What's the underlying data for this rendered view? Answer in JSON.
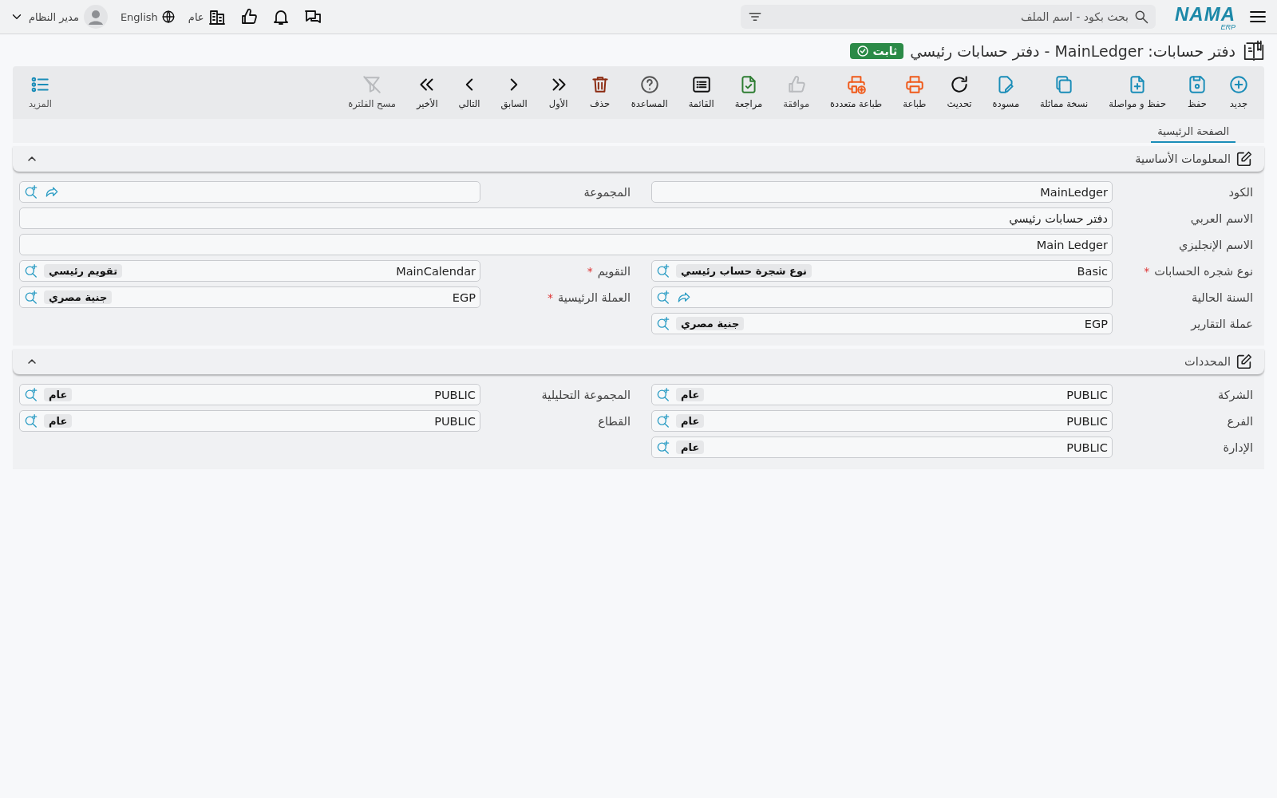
{
  "topbar": {
    "logo": {
      "name": "NAMA",
      "sub": "ERP"
    },
    "search": {
      "placeholder": "بحث بكود - اسم الملف"
    },
    "branch": "عام",
    "language": "English",
    "user": "مدير النظام"
  },
  "title": {
    "text": "دفتر حسابات: MainLedger - دفتر حسابات رئيسي",
    "status": "ثابت"
  },
  "toolbar": [
    {
      "label": "جديد",
      "kind": "new",
      "disabled": false
    },
    {
      "label": "حفظ",
      "kind": "save",
      "disabled": false
    },
    {
      "label": "حفظ و مواصلة",
      "kind": "continue",
      "disabled": false
    },
    {
      "label": "نسخة مماثلة",
      "kind": "duplicate",
      "disabled": false
    },
    {
      "label": "مسودة",
      "kind": "draft",
      "disabled": false
    },
    {
      "label": "تحديث",
      "kind": "refresh",
      "disabled": false
    },
    {
      "label": "طباعة",
      "kind": "print",
      "disabled": false
    },
    {
      "label": "طباعة متعددة",
      "kind": "multiprint",
      "disabled": false
    },
    {
      "label": "موافقة",
      "kind": "approve",
      "disabled": true
    },
    {
      "label": "مراجعة",
      "kind": "review",
      "disabled": false
    },
    {
      "label": "القائمة",
      "kind": "list",
      "disabled": false
    },
    {
      "label": "المساعدة",
      "kind": "help",
      "disabled": false
    },
    {
      "label": "حذف",
      "kind": "delete",
      "disabled": false
    },
    {
      "label": "الأول",
      "kind": "first",
      "disabled": false
    },
    {
      "label": "السابق",
      "kind": "previous",
      "disabled": false
    },
    {
      "label": "التالي",
      "kind": "next",
      "disabled": false
    },
    {
      "label": "الأخير",
      "kind": "last",
      "disabled": false
    },
    {
      "label": "مسح الفلترة",
      "kind": "clearfilter",
      "disabled": true
    }
  ],
  "more": {
    "label": "المزيد"
  },
  "tabs": [
    {
      "label": "الصفحة الرئيسية",
      "selected": true
    }
  ],
  "sections": [
    {
      "title": "المعلومات الأساسية",
      "expanded": true,
      "rows": [
        [
          {
            "label": "الكود",
            "kind": "text",
            "value": "MainLedger"
          },
          {
            "label": "المجموعة",
            "kind": "lookup",
            "goto": true
          }
        ],
        [
          {
            "label": "الاسم العربي",
            "kind": "text",
            "value": "دفتر حسابات رئيسي",
            "wide": true
          }
        ],
        [
          {
            "label": "الاسم الإنجليزي",
            "kind": "text",
            "value": "Main Ledger",
            "wide": true
          }
        ],
        [
          {
            "label": "نوع شجره الحسابات",
            "kind": "lookup",
            "required_mark": "*",
            "value": "Basic",
            "tag": "نوع شجرة حساب رئيسي"
          },
          {
            "label": "التقويم",
            "kind": "lookup",
            "required_mark": "*",
            "value": "MainCalendar",
            "tag": "تقويم رئيسي"
          }
        ],
        [
          {
            "label": "السنة الحالية",
            "kind": "lookup",
            "goto": true
          },
          {
            "label": "العملة الرئيسية",
            "kind": "lookup",
            "required_mark": "*",
            "value": "EGP",
            "tag": "جنية مصري"
          }
        ],
        [
          {
            "label": "عملة التقارير",
            "kind": "lookup",
            "value": "EGP",
            "tag": "جنية مصري"
          }
        ]
      ]
    },
    {
      "title": "المحددات",
      "expanded": true,
      "rows": [
        [
          {
            "label": "الشركة",
            "kind": "lookup",
            "value": "PUBLIC",
            "tag": "عام"
          },
          {
            "label": "المجموعة التحليلية",
            "kind": "lookup",
            "value": "PUBLIC",
            "tag": "عام"
          }
        ],
        [
          {
            "label": "الفرع",
            "kind": "lookup",
            "value": "PUBLIC",
            "tag": "عام"
          },
          {
            "label": "القطاع",
            "kind": "lookup",
            "value": "PUBLIC",
            "tag": "عام"
          }
        ],
        [
          {
            "label": "الإدارة",
            "kind": "lookup",
            "value": "PUBLIC",
            "tag": "عام"
          }
        ]
      ]
    }
  ]
}
